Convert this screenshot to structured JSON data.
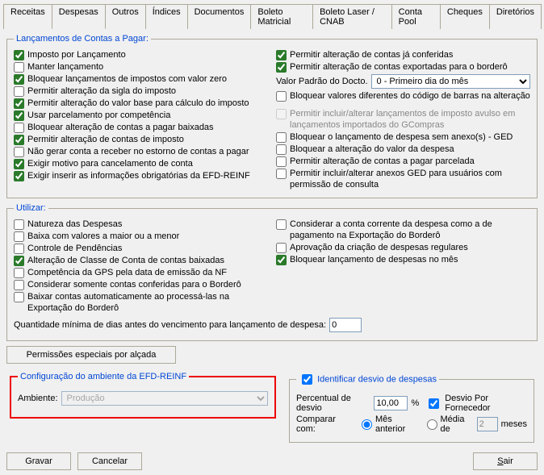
{
  "tabs": [
    "Receitas",
    "Despesas",
    "Outros",
    "Índices",
    "Documentos",
    "Boleto Matricial",
    "Boleto Laser / CNAB",
    "Conta Pool",
    "Cheques",
    "Diretórios"
  ],
  "active_tab": 1,
  "lanc": {
    "legend": "Lançamentos de Contas a Pagar:",
    "left": [
      {
        "label": "Imposto por Lançamento",
        "checked": true
      },
      {
        "label": "Manter lançamento",
        "checked": false
      },
      {
        "label": "Bloquear lançamentos de impostos com valor zero",
        "checked": true
      },
      {
        "label": "Permitir alteração da sigla do imposto",
        "checked": false
      },
      {
        "label": "Permitir alteração do valor base para cálculo do imposto",
        "checked": true
      },
      {
        "label": "Usar parcelamento por competência",
        "checked": true
      },
      {
        "label": "Bloquear alteração de contas a pagar baixadas",
        "checked": false
      },
      {
        "label": "Permitir alteração de contas de imposto",
        "checked": true
      },
      {
        "label": "Não gerar conta a receber no estorno de contas a pagar",
        "checked": false
      },
      {
        "label": "Exigir motivo para cancelamento de conta",
        "checked": true
      },
      {
        "label": "Exigir inserir as informações obrigatórias da EFD-REINF",
        "checked": true
      }
    ],
    "right_top": [
      {
        "label": "Permitir alteração de contas já conferidas",
        "checked": true
      },
      {
        "label": "Permitir alteração de contas exportadas para o borderô",
        "checked": true
      }
    ],
    "valor_padrao_label": "Valor Padrão do Docto.",
    "valor_padrao_value": "0 - Primeiro dia do mês",
    "bloq_bar": {
      "label": "Bloquear valores diferentes do código de barras na alteração",
      "checked": false
    },
    "disabled_item": {
      "label": "Permitir incluir/alterar lançamentos de imposto avulso em lançamentos importados do GCompras",
      "checked": false
    },
    "right_bottom": [
      {
        "label": "Bloquear o lançamento de despesa sem anexo(s) - GED",
        "checked": false
      },
      {
        "label": "Bloquear a alteração do valor da despesa",
        "checked": false
      },
      {
        "label": "Permitir alteração de contas a pagar parcelada",
        "checked": false
      },
      {
        "label": "Permitir incluir/alterar anexos GED para usuários com permissão de consulta",
        "checked": false
      }
    ]
  },
  "utilizar": {
    "legend": "Utilizar:",
    "left": [
      {
        "label": "Natureza das Despesas",
        "checked": false
      },
      {
        "label": "Baixa com valores a maior ou a menor",
        "checked": false
      },
      {
        "label": "Controle de Pendências",
        "checked": false
      },
      {
        "label": "Alteração de Classe de Conta de contas baixadas",
        "checked": true
      },
      {
        "label": "Competência da GPS pela data de emissão da NF",
        "checked": false
      },
      {
        "label": "Considerar somente contas conferidas para o Borderô",
        "checked": false
      },
      {
        "label": "Baixar contas automaticamente ao processá-las na Exportação do Borderô",
        "checked": false
      }
    ],
    "right": [
      {
        "label": "Considerar a conta corrente da despesa como a de pagamento na Exportação do Borderô",
        "checked": false
      },
      {
        "label": "Aprovação da criação de despesas regulares",
        "checked": false
      },
      {
        "label": "Bloquear lançamento de despesas no mês",
        "checked": true
      }
    ],
    "dias_label": "Quantidade mínima de dias antes do vencimento para lançamento de despesa:",
    "dias_value": "0"
  },
  "perm_button": "Permissões especiais por alçada",
  "efd": {
    "legend": "Configuração do ambiente da EFD-REINF",
    "ambiente_label": "Ambiente:",
    "ambiente_value": "Produção"
  },
  "desvio": {
    "legend": "Identificar desvio de despesas",
    "legend_checked": true,
    "percentual_label": "Percentual de desvio",
    "percentual_value": "10,00",
    "percent_sign": "%",
    "por_fornecedor": {
      "label": "Desvio Por Fornecedor",
      "checked": true
    },
    "comparar_label": "Comparar com:",
    "radio_mes": "Mês anterior",
    "radio_media": "Média de",
    "media_value": "2",
    "meses_label": "meses"
  },
  "buttons": {
    "gravar": "Gravar",
    "cancelar": "Cancelar",
    "sair": "Sair"
  }
}
